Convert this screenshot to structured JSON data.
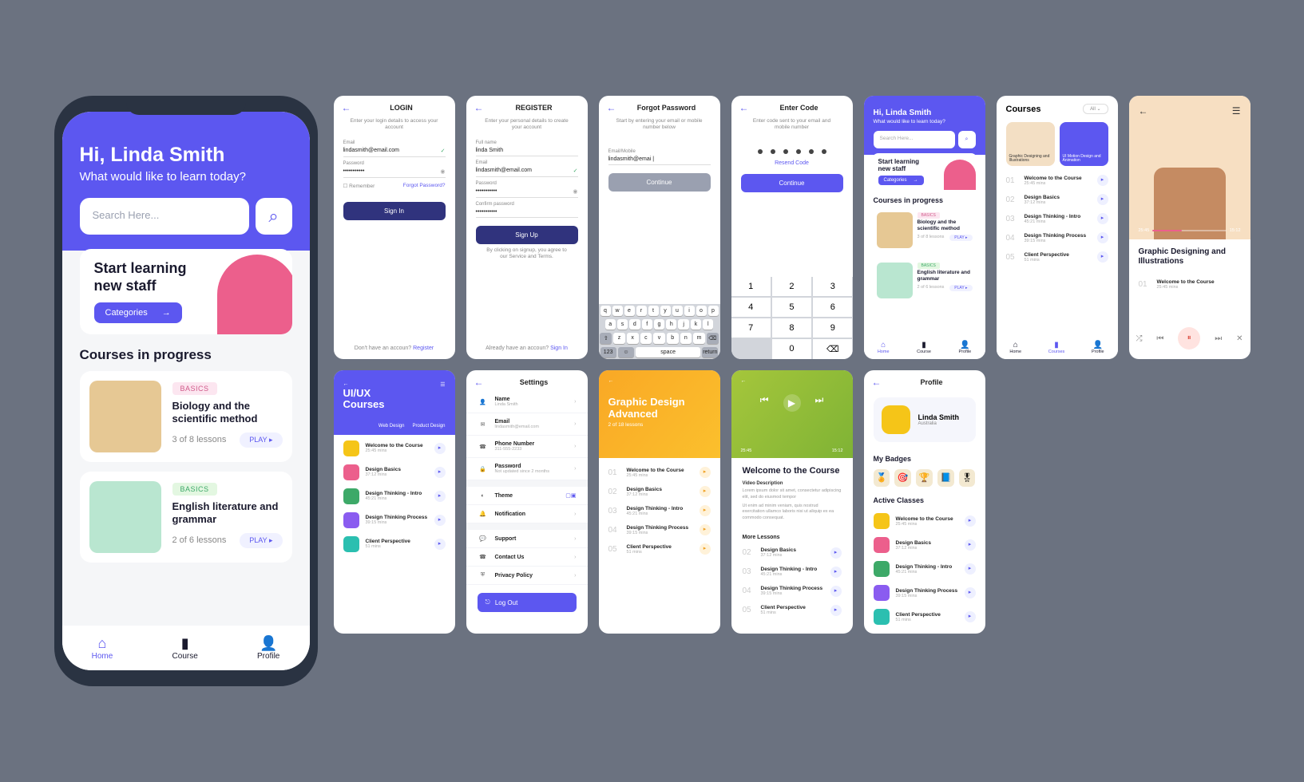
{
  "hero": {
    "greeting": "Hi, Linda Smith",
    "prompt": "What would like to learn today?",
    "searchPlaceholder": "Search Here..."
  },
  "promo": {
    "line1": "Start learning",
    "line2": "new staff",
    "cta": "Categories"
  },
  "section_progress": "Courses in progress",
  "courseA": {
    "tag": "BASICS",
    "title": "Biology and the scientific method",
    "lessons": "3 of 8 lessons",
    "play": "PLAY"
  },
  "courseB": {
    "tag": "BASICS",
    "title": "English literature and grammar",
    "lessons": "2 of 6 lessons",
    "play": "PLAY"
  },
  "tabs": {
    "home": "Home",
    "course": "Course",
    "profile": "Profile"
  },
  "login": {
    "title": "LOGIN",
    "sub": "Enter your login details to access your account",
    "emailL": "Email",
    "email": "lindasmith@email.com",
    "pwdL": "Password",
    "pwd": "•••••••••••",
    "remember": "Remember",
    "forgot": "Forgot Password?",
    "signin": "Sign In",
    "foot": "Don't have an accoun? ",
    "footLink": "Register"
  },
  "register": {
    "title": "REGISTER",
    "sub": "Enter your personal details to create your account",
    "fullL": "Full name",
    "full": "linda Smith",
    "emailL": "Email",
    "email": "lindasmith@email.com",
    "pwdL": "Password",
    "pwd": "•••••••••••",
    "confL": "Confirm password",
    "conf": "•••••••••••",
    "signup": "Sign Up",
    "terms": "By clicking on signup, you agree to our Service and Terms.",
    "foot": "Already have an accoun? ",
    "footLink": "Sign In"
  },
  "forgot": {
    "title": "Forgot Password",
    "sub": "Start by entering your email or mobile number below",
    "emL": "Email/Mobile",
    "em": "lindasmith@emai |",
    "continue": "Continue",
    "row1": [
      "q",
      "w",
      "e",
      "r",
      "t",
      "y",
      "u",
      "i",
      "o",
      "p"
    ],
    "row2": [
      "a",
      "s",
      "d",
      "f",
      "g",
      "h",
      "j",
      "k",
      "l"
    ],
    "row3": [
      "⇧",
      "z",
      "x",
      "c",
      "v",
      "b",
      "n",
      "m",
      "⌫"
    ],
    "row4": [
      "123",
      "☺",
      "space",
      "return"
    ]
  },
  "code": {
    "title": "Enter Code",
    "sub": "Enter code sent to your email and mobile number",
    "resend": "Resend Code",
    "continue": "Continue",
    "numpad": [
      "1",
      "2",
      "3",
      "4",
      "5",
      "6",
      "7",
      "8",
      "9",
      "",
      "0",
      "⌫"
    ]
  },
  "coursesScreen": {
    "title": "Courses",
    "filter": "All",
    "tile1": "Graphic Designing and Illustrations",
    "tile2": "UI Motion Design and Animation",
    "items": [
      {
        "n": "01",
        "t": "Welcome to the Course",
        "s": "25:45 mins"
      },
      {
        "n": "02",
        "t": "Design Basics",
        "s": "37:12 mins"
      },
      {
        "n": "03",
        "t": "Design Thinking - Intro",
        "s": "45:21 mins"
      },
      {
        "n": "04",
        "t": "Design Thinking Process",
        "s": "39:15 mins"
      },
      {
        "n": "05",
        "t": "Client Perspective",
        "s": "51 mins"
      }
    ]
  },
  "category": {
    "title": "Graphic Designing and Illustrations",
    "t1": "25:45",
    "t2": "15:12",
    "lesson": "Welcome to the Course",
    "lessonSub": "25:45 mins"
  },
  "uiux": {
    "title": "UI/UX\nCourses",
    "tabA": "Web Design",
    "tabB": "Product Design",
    "items": [
      {
        "c": "#f5c518",
        "t": "Welcome to the Course",
        "s": "25:45 mins"
      },
      {
        "c": "#ec5f8c",
        "t": "Design Basics",
        "s": "37:12 mins"
      },
      {
        "c": "#3da968",
        "t": "Design Thinking - Intro",
        "s": "45:21 mins"
      },
      {
        "c": "#8a5cf0",
        "t": "Design Thinking Process",
        "s": "39:15 mins"
      },
      {
        "c": "#2bbfb0",
        "t": "Client Perspective",
        "s": "51 mins"
      }
    ]
  },
  "settings": {
    "title": "Settings",
    "name": {
      "l": "Name",
      "v": "Linda Smith"
    },
    "email": {
      "l": "Email",
      "v": "lindasmith@email.com"
    },
    "phone": {
      "l": "Phone Number",
      "v": "311-555-2233"
    },
    "pwd": {
      "l": "Password",
      "v": "Not updated since 2 months"
    },
    "theme": "Theme",
    "notif": "Notification",
    "support": "Support",
    "contact": "Contact Us",
    "privacy": "Privacy Policy",
    "logout": "Log Out"
  },
  "orange": {
    "title": "Graphic Design Advanced",
    "sub": "2 of 18 lessons",
    "items": [
      {
        "n": "01",
        "t": "Welcome to the Course",
        "s": "25:45 mins"
      },
      {
        "n": "02",
        "t": "Design Basics",
        "s": "37:12 mins"
      },
      {
        "n": "03",
        "t": "Design Thinking - Intro",
        "s": "45:21 mins"
      },
      {
        "n": "04",
        "t": "Design Thinking Process",
        "s": "39:15 mins"
      },
      {
        "n": "05",
        "t": "Client Perspective",
        "s": "51 mins"
      }
    ]
  },
  "green": {
    "welcome": "Welcome to the Course",
    "vd": "Video Description",
    "p1": "Lorem ipsum dolor sit amet, consectetur adipiscing elit, sed do eiusmod tempor",
    "p2": "Ut enim ad minim veniam, quis nostrud exercitation ullamco laboris nisi ut aliquip ex ea commodo consequat.",
    "more": "More Lessons",
    "t1": "25:45",
    "t2": "15:12",
    "items": [
      {
        "n": "02",
        "t": "Design Basics",
        "s": "37:12 mins"
      },
      {
        "n": "03",
        "t": "Design Thinking - Intro",
        "s": "45:21 mins"
      },
      {
        "n": "04",
        "t": "Design Thinking Process",
        "s": "39:15 mins"
      },
      {
        "n": "05",
        "t": "Client Perspective",
        "s": "51 mins"
      }
    ]
  },
  "profile": {
    "title": "Profile",
    "name": "Linda Smith",
    "location": "Australia",
    "badges": "My Badges",
    "badgeIcons": [
      "🏅",
      "🎯",
      "🏆",
      "📘",
      "🎖"
    ],
    "active": "Active Classes",
    "items": [
      {
        "c": "#f5c518",
        "t": "Welcome to the Course",
        "s": "25:45 mins"
      },
      {
        "c": "#ec5f8c",
        "t": "Design Basics",
        "s": "37:12 mins"
      },
      {
        "c": "#3da968",
        "t": "Design Thinking - Intro",
        "s": "45:21 mins"
      },
      {
        "c": "#8a5cf0",
        "t": "Design Thinking Process",
        "s": "39:15 mins"
      },
      {
        "c": "#2bbfb0",
        "t": "Client Perspective",
        "s": "51 mins"
      }
    ]
  },
  "tabsSmall": {
    "home": "Home",
    "course": "Course",
    "profile": "Profile",
    "courses": "Courses"
  }
}
